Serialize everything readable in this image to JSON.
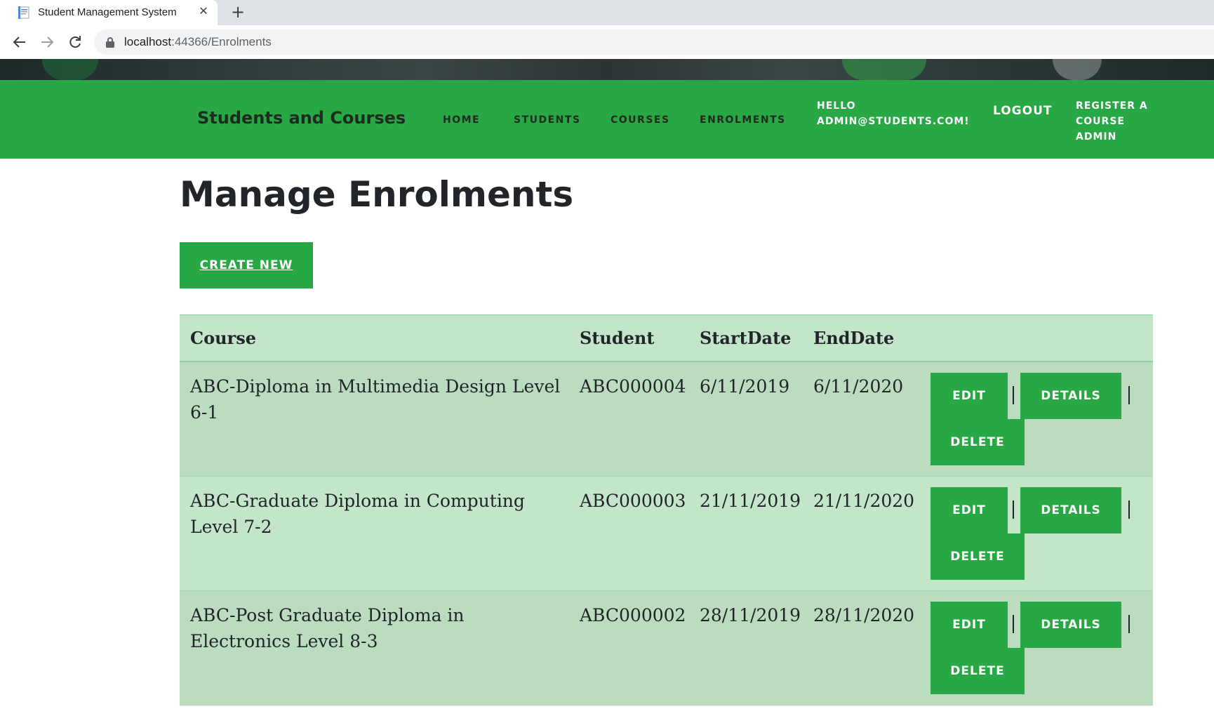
{
  "browser": {
    "tab_title": "Student Management System",
    "url_host": "localhost",
    "url_rest": ":44366/Enrolments"
  },
  "navbar": {
    "brand": "Students and Courses",
    "links": [
      "HOME",
      "STUDENTS",
      "COURSES",
      "ENROLMENTS"
    ],
    "hello": "HELLO ADMIN@STUDENTS.COM!",
    "logout": "LOGOUT",
    "register": "REGISTER A COURSE ADMIN"
  },
  "page": {
    "title": "Manage Enrolments",
    "create_new": "CREATE NEW"
  },
  "table": {
    "headers": [
      "Course",
      "Student",
      "StartDate",
      "EndDate"
    ],
    "rows": [
      {
        "course": "ABC-Diploma in Multimedia Design Level 6-1",
        "student": "ABC000004",
        "start": "6/11/2019",
        "end": "6/11/2020"
      },
      {
        "course": "ABC-Graduate Diploma in Computing Level 7-2",
        "student": "ABC000003",
        "start": "21/11/2019",
        "end": "21/11/2020"
      },
      {
        "course": "ABC-Post Graduate Diploma in Electronics Level 8-3",
        "student": "ABC000002",
        "start": "28/11/2019",
        "end": "28/11/2020"
      }
    ],
    "actions": {
      "edit": "EDIT",
      "details": "DETAILS",
      "delete": "DELETE",
      "separator": "|"
    }
  },
  "colors": {
    "accent": "#28a745",
    "row_light": "#c3e6cb",
    "row_dark": "#bcdcc0"
  },
  "icons": [
    "document-icon",
    "close-icon",
    "plus-icon",
    "back-arrow-icon",
    "forward-arrow-icon",
    "reload-icon",
    "lock-icon"
  ]
}
